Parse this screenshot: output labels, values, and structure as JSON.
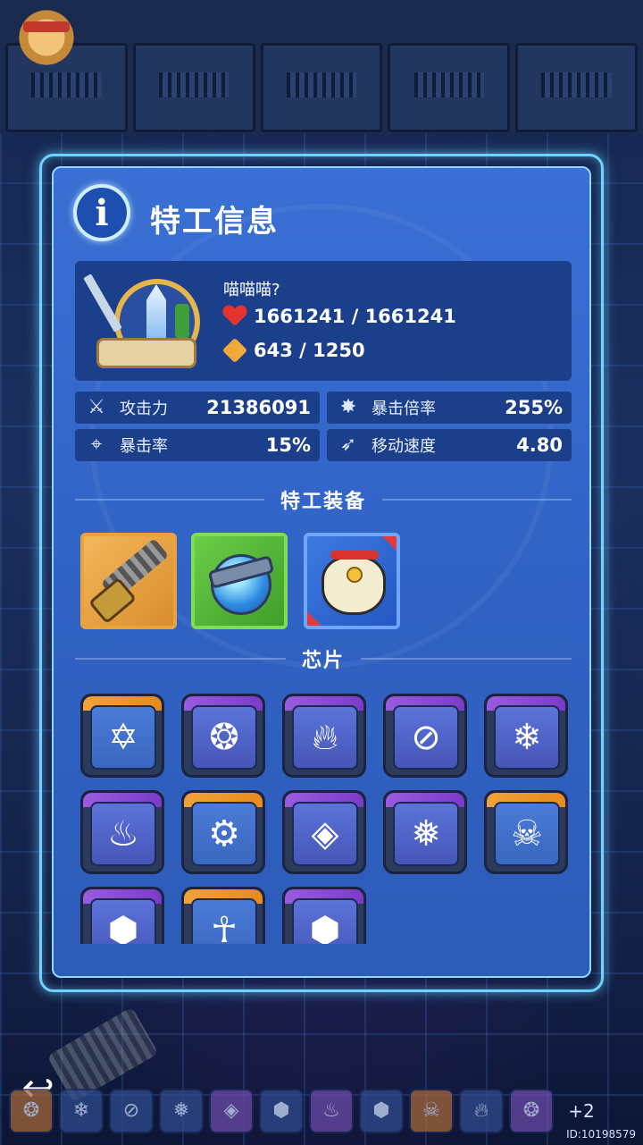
{
  "panel": {
    "title": "特工信息",
    "info_icon": "i"
  },
  "pet": {
    "name": "喵喵喵?",
    "hp": "1661241 / 1661241",
    "energy": "643 / 1250"
  },
  "attributes": [
    {
      "icon": "sword-icon",
      "glyph": "⚔",
      "label": "攻击力",
      "value": "21386091"
    },
    {
      "icon": "burst-icon",
      "glyph": "✸",
      "label": "暴击倍率",
      "value": "255%"
    },
    {
      "icon": "crosshair-icon",
      "glyph": "⌖",
      "label": "暴击率",
      "value": "15%"
    },
    {
      "icon": "boot-icon",
      "glyph": "➶",
      "label": "移动速度",
      "value": "4.80"
    }
  ],
  "sections": {
    "equipment": "特工装备",
    "chips": "芯片"
  },
  "equipment": [
    {
      "name": "chainsaw",
      "rarity": "gold"
    },
    {
      "name": "bomb",
      "rarity": "green"
    },
    {
      "name": "bell-bag",
      "rarity": "blue"
    }
  ],
  "chips": [
    {
      "icon": "hexagram-icon",
      "glyph": "✡",
      "rim": "orange"
    },
    {
      "icon": "bubbles-icon",
      "glyph": "❂",
      "rim": "purple"
    },
    {
      "icon": "flame-icon",
      "glyph": "🔥︎",
      "rim": "purple"
    },
    {
      "icon": "no-lightning-icon",
      "glyph": "⊘",
      "rim": "purple"
    },
    {
      "icon": "snowflake-icon",
      "glyph": "❄",
      "rim": "purple"
    },
    {
      "icon": "spirit-icon",
      "glyph": "♨",
      "rim": "purple"
    },
    {
      "icon": "gear-arrow-icon",
      "glyph": "⚙",
      "rim": "orange"
    },
    {
      "icon": "crystal-shield-icon",
      "glyph": "◈",
      "rim": "purple"
    },
    {
      "icon": "ice-shard-icon",
      "glyph": "❅",
      "rim": "purple"
    },
    {
      "icon": "skull-arrow-icon",
      "glyph": "☠",
      "rim": "orange"
    },
    {
      "icon": "drop-shield-icon",
      "glyph": "⬢",
      "rim": "purple"
    },
    {
      "icon": "angel-icon",
      "glyph": "☥",
      "rim": "orange"
    },
    {
      "icon": "drop-shield-icon",
      "glyph": "⬢",
      "rim": "purple"
    }
  ],
  "bottom": {
    "back": "↩",
    "more": "+2",
    "player_id": "ID:10198579",
    "mini_chips": [
      "❂",
      "❄",
      "⊘",
      "❅",
      "◈",
      "⬢",
      "♨",
      "⬢",
      "☠",
      "🔥︎",
      "❂"
    ]
  },
  "colors": {
    "panel": "#3163c5",
    "frame_glow": "#6fd3ff",
    "card": "#1c3f8c",
    "chip_orange": "#f0a23a",
    "chip_purple": "#9a5be0"
  }
}
